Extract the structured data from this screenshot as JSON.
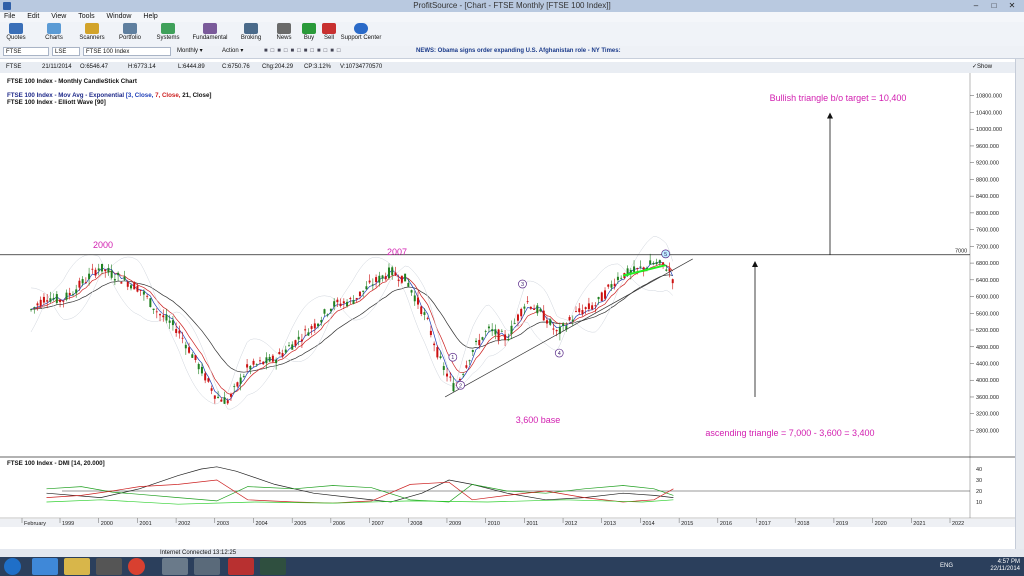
{
  "window": {
    "title": "ProfitSource - [Chart - FTSE Monthly [FTSE 100 Index]]"
  },
  "menu": [
    "File",
    "Edit",
    "View",
    "Tools",
    "Window",
    "Help"
  ],
  "toolbar": [
    "Quotes",
    "Charts",
    "Scanners",
    "Portfolio",
    "Systems",
    "Fundamental",
    "Broking",
    "News",
    "Buy",
    "Sell",
    "Support Center"
  ],
  "address": {
    "symbol": "FTSE",
    "exchange": "LSE",
    "name": "FTSE 100 Index",
    "period": "Monthly",
    "action": "Action",
    "news": "NEWS: Obama signs order expanding U.S. Afghanistan role - NY Times:"
  },
  "info": {
    "sym": "FTSE",
    "date": "21/11/2014",
    "open": "O:6546.47",
    "high": "H:6773.14",
    "low": "L:6444.89",
    "close": "C:6750.76",
    "chg": "Chg:204.29",
    "cp": "CP:3.12%",
    "vol": "V:10734770570",
    "show_last": "Show Last"
  },
  "chart_data": {
    "type": "candlestick",
    "title": "FTSE 100 Index - Monthly CandleStick Chart",
    "studies": [
      "FTSE 100 Index - Mov Avg - Exponential [3, Close, 7, Close, 21, Close]",
      "FTSE 100 Index - Elliott Wave [90]"
    ],
    "ma_legend": {
      "prefix": "FTSE 100 Index - Mov Avg - Exponential ",
      "p1": "[3, Close, ",
      "p2": "7, Close, ",
      "p3": "21, Close]"
    },
    "yticks": [
      2800,
      3200,
      3600,
      4000,
      4400,
      4800,
      5200,
      5600,
      6000,
      6400,
      6800,
      7200,
      7600,
      8000,
      8400,
      8800,
      9200,
      9600,
      10000,
      10400,
      10800
    ],
    "ytick_labels": [
      "2800.000",
      "3200.000",
      "3600.000",
      "4000.000",
      "4400.000",
      "4800.000",
      "5200.000",
      "5600.000",
      "6000.000",
      "6400.000",
      "6800.000",
      "7200.000",
      "7600.000",
      "8000.000",
      "8400.000",
      "8800.000",
      "9200.000",
      "9600.000",
      "10000.000",
      "10400.000",
      "10800.000"
    ],
    "ylim": [
      2500,
      11200
    ],
    "xlabels": [
      "February",
      "1999",
      "2000",
      "2001",
      "2002",
      "2003",
      "2004",
      "2005",
      "2006",
      "2007",
      "2008",
      "2009",
      "2010",
      "2011",
      "2012",
      "2013",
      "2014",
      "2015",
      "2016",
      "2017",
      "2018",
      "2019",
      "2020",
      "2021",
      "2022"
    ],
    "price_path": [
      [
        1998.1,
        5600
      ],
      [
        1998.6,
        6000
      ],
      [
        1999.0,
        5900
      ],
      [
        1999.5,
        6300
      ],
      [
        1999.95,
        6700
      ],
      [
        2000.6,
        6400
      ],
      [
        2001.0,
        6200
      ],
      [
        2001.5,
        5600
      ],
      [
        2002.0,
        5200
      ],
      [
        2002.5,
        4400
      ],
      [
        2003.0,
        3600
      ],
      [
        2003.3,
        3500
      ],
      [
        2003.8,
        4300
      ],
      [
        2004.5,
        4500
      ],
      [
        2005.0,
        4900
      ],
      [
        2005.5,
        5300
      ],
      [
        2006.0,
        5800
      ],
      [
        2006.5,
        5900
      ],
      [
        2007.0,
        6300
      ],
      [
        2007.5,
        6600
      ],
      [
        2007.9,
        6400
      ],
      [
        2008.4,
        5500
      ],
      [
        2008.8,
        4400
      ],
      [
        2009.15,
        3800
      ],
      [
        2009.6,
        4700
      ],
      [
        2010.0,
        5200
      ],
      [
        2010.5,
        5000
      ],
      [
        2011.0,
        5900
      ],
      [
        2011.5,
        5500
      ],
      [
        2011.8,
        5100
      ],
      [
        2012.3,
        5600
      ],
      [
        2012.8,
        5800
      ],
      [
        2013.4,
        6500
      ],
      [
        2013.8,
        6600
      ],
      [
        2014.3,
        6800
      ],
      [
        2014.65,
        6700
      ],
      [
        2014.85,
        6300
      ]
    ],
    "horizontal_line": {
      "value": 7000,
      "label": "7000"
    },
    "wave_labels": [
      {
        "label": "1",
        "x": 2009.1,
        "y": 4550
      },
      {
        "label": "2",
        "x": 2009.3,
        "y": 3880
      },
      {
        "label": "3",
        "x": 2010.9,
        "y": 6300
      },
      {
        "label": "4",
        "x": 2011.85,
        "y": 4650
      },
      {
        "label": "5",
        "x": 2014.6,
        "y": 7020
      }
    ],
    "annotations": [
      "2000",
      "2007",
      "3,600 base",
      "ascending triangle = 7,000 - 3,600 = 3,400",
      "Bullish triangle b/o target = 10,400"
    ],
    "dmi": {
      "title": "FTSE 100 Index - DMI [14, 20.000]",
      "yticks": [
        10,
        20,
        30,
        40
      ],
      "level": 20
    }
  },
  "colors": {
    "ma3": "#1f3fb8",
    "ma7": "#cc2020",
    "ma21": "#333333",
    "annot": "#d21fb0",
    "bull": "#208020",
    "bear": "#cc1010",
    "baseline": "#20c020"
  },
  "status": {
    "connection": "Internet Connected 13:12:25"
  },
  "clock": {
    "time": "4:57 PM",
    "date": "22/11/2014",
    "lang": "ENG"
  }
}
